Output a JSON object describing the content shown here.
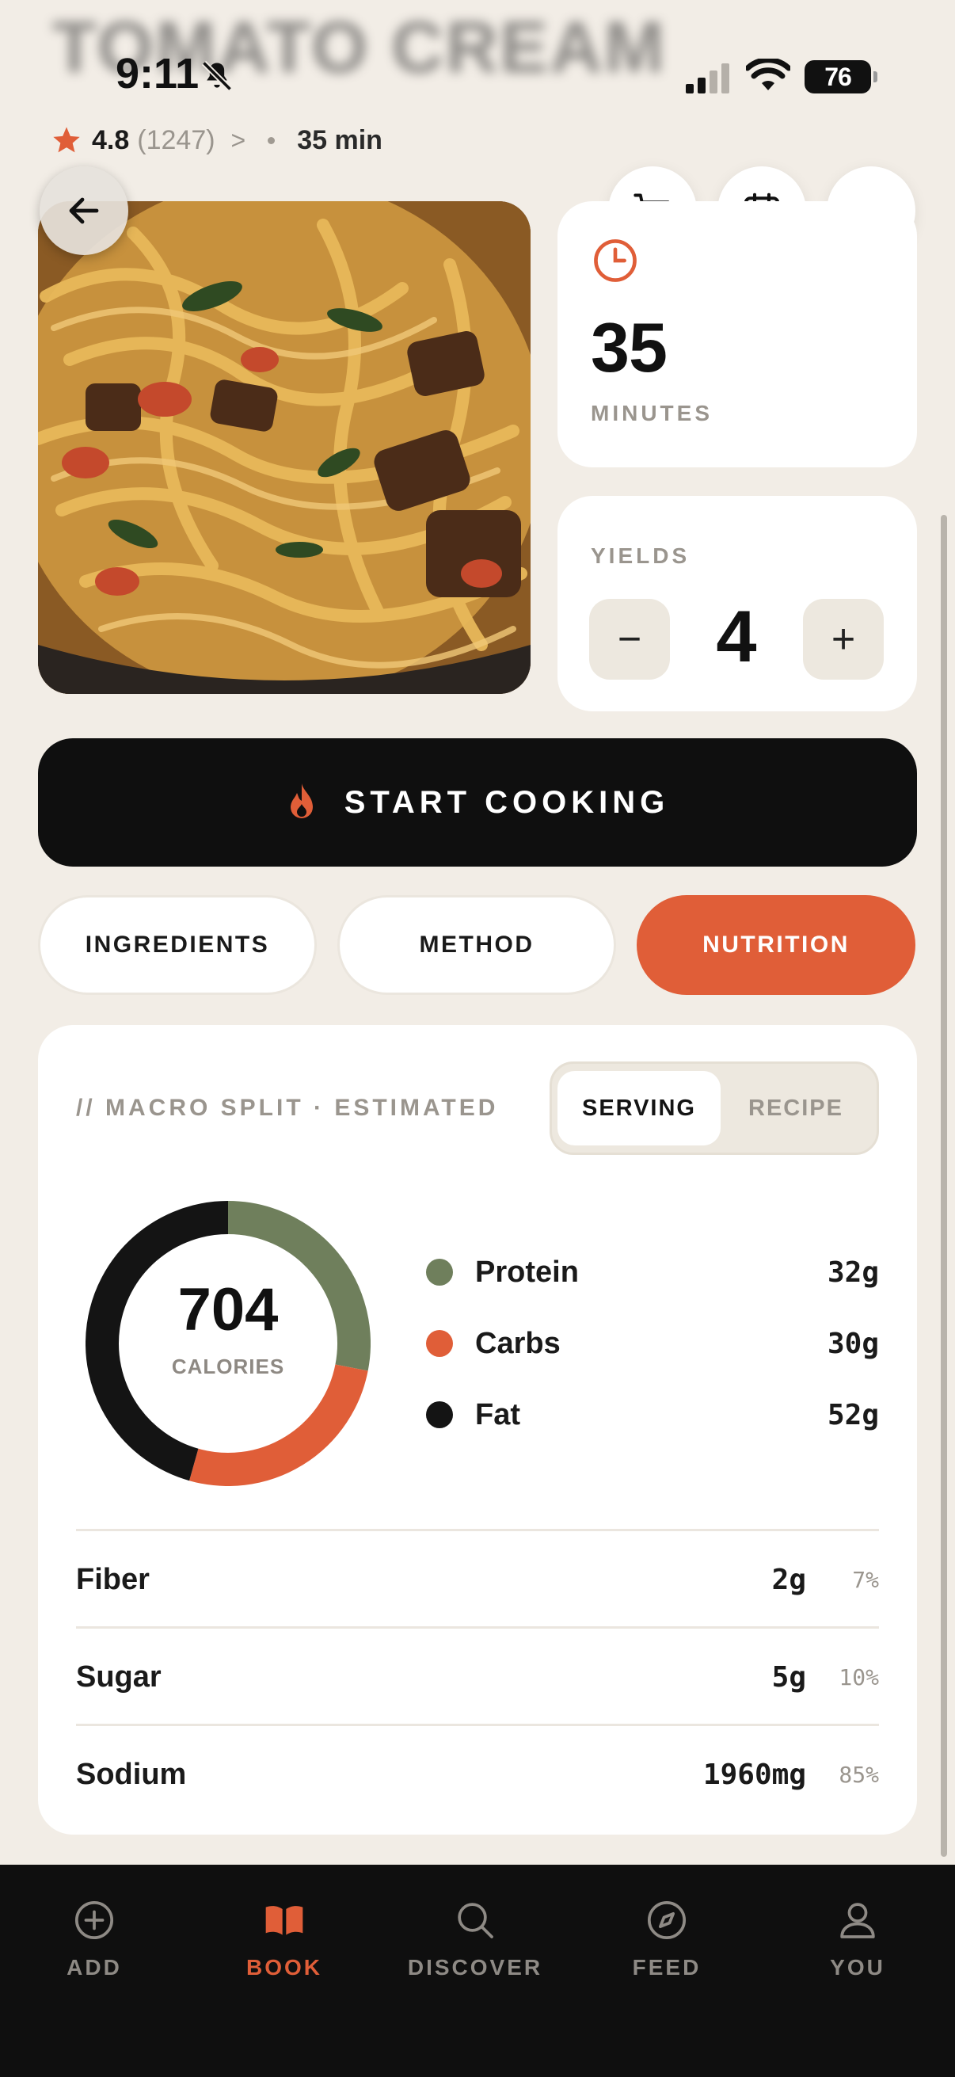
{
  "header": {
    "blurred_title": "TOMATO CREAM"
  },
  "status_bar": {
    "time": "9:11",
    "battery": "76"
  },
  "recipe": {
    "rating": "4.8",
    "review_count": "(1247)",
    "chevron": ">",
    "duration": "35 min"
  },
  "time_card": {
    "value": "35",
    "unit": "MINUTES"
  },
  "yields_card": {
    "label": "YIELDS",
    "value": "4",
    "decrement": "−",
    "increment": "+"
  },
  "start_button": {
    "label": "START COOKING"
  },
  "tabs": [
    {
      "label": "INGREDIENTS",
      "active": false
    },
    {
      "label": "METHOD",
      "active": false
    },
    {
      "label": "NUTRITION",
      "active": true
    }
  ],
  "nutrition": {
    "section_title": "// MACRO SPLIT · ESTIMATED",
    "toggle": {
      "options": [
        "SERVING",
        "RECIPE"
      ],
      "selected": "SERVING"
    },
    "calories": {
      "value": "704",
      "label": "CALORIES"
    },
    "macros": [
      {
        "name": "Protein",
        "value": "32g",
        "grams": 32,
        "color": "#6f7f5c"
      },
      {
        "name": "Carbs",
        "value": "30g",
        "grams": 30,
        "color": "#e05e38"
      },
      {
        "name": "Fat",
        "value": "52g",
        "grams": 52,
        "color": "#141414"
      }
    ],
    "details": [
      {
        "name": "Fiber",
        "value": "2g",
        "percent": "7%"
      },
      {
        "name": "Sugar",
        "value": "5g",
        "percent": "10%"
      },
      {
        "name": "Sodium",
        "value": "1960mg",
        "percent": "85%"
      }
    ]
  },
  "bottom_nav": [
    {
      "label": "ADD",
      "icon": "add-circle-icon",
      "active": false
    },
    {
      "label": "BOOK",
      "icon": "book-icon",
      "active": true
    },
    {
      "label": "DISCOVER",
      "icon": "search-icon",
      "active": false
    },
    {
      "label": "FEED",
      "icon": "compass-icon",
      "active": false
    },
    {
      "label": "YOU",
      "icon": "person-icon",
      "active": false
    }
  ],
  "colors": {
    "accent": "#e05e38",
    "background": "#f2ede6",
    "protein": "#6f7f5c",
    "dark": "#0f0f0f"
  }
}
